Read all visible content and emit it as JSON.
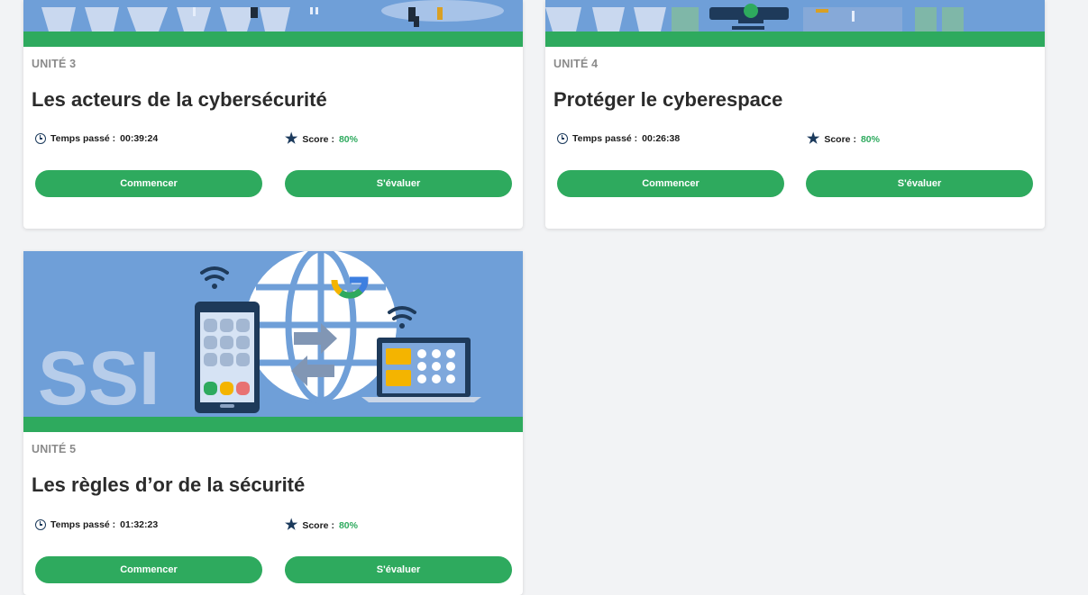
{
  "colors": {
    "accent": "#2eaa5e",
    "banner": "#6f9fd8",
    "icon": "#1b3a5c"
  },
  "cards": [
    {
      "unit": "UNITÉ 3",
      "title": "Les acteurs de la cybersécurité",
      "time_label": "Temps passé :",
      "time": "00:39:24",
      "score_label": "Score :",
      "score": "80%",
      "start": "Commencer",
      "evaluate": "S'évaluer"
    },
    {
      "unit": "UNITÉ 4",
      "title": "Protéger le cyberespace",
      "time_label": "Temps passé :",
      "time": "00:26:38",
      "score_label": "Score :",
      "score": "80%",
      "start": "Commencer",
      "evaluate": "S'évaluer"
    },
    {
      "unit": "UNITÉ 5",
      "title": "Les règles d’or de la sécurité",
      "time_label": "Temps passé :",
      "time": "01:32:23",
      "score_label": "Score :",
      "score": "80%",
      "start": "Commencer",
      "evaluate": "S'évaluer",
      "image_text": "SSI"
    }
  ]
}
